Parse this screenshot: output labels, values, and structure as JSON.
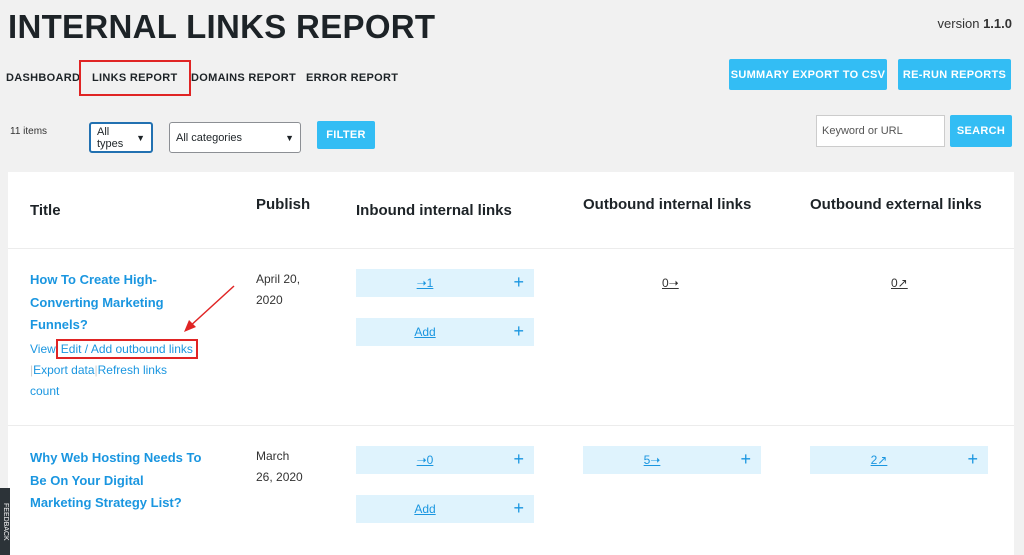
{
  "header": {
    "title": "INTERNAL LINKS REPORT",
    "version_prefix": "version ",
    "version_number": "1.1.0"
  },
  "tabs": [
    {
      "label": "DASHBOARD"
    },
    {
      "label": "LINKS REPORT"
    },
    {
      "label": "DOMAINS REPORT"
    },
    {
      "label": "ERROR REPORT"
    }
  ],
  "buttons": {
    "summary_export": "SUMMARY EXPORT TO CSV",
    "rerun": "RE-RUN REPORTS",
    "filter": "FILTER",
    "search": "SEARCH"
  },
  "filters": {
    "items_count": "11 items",
    "type_selected": "All types",
    "category_selected": "All categories",
    "search_placeholder": "Keyword or URL"
  },
  "table": {
    "headers": {
      "title": "Title",
      "publish": "Publish",
      "inbound": "Inbound internal links",
      "outbound_internal": "Outbound internal links",
      "outbound_external": "Outbound external links"
    },
    "rows": [
      {
        "title_lines": [
          "How To Create High-",
          "Converting Marketing",
          "Funnels?"
        ],
        "date_lines": [
          "April 20,",
          "2020"
        ],
        "actions": {
          "view": "View",
          "edit": "Edit / Add outbound links",
          "export": "Export data",
          "refresh_1": "Refresh links",
          "refresh_2": "count"
        },
        "inbound": "➝1",
        "inbound_add": "Add",
        "outbound_internal": "0➝",
        "outbound_external": "0↗"
      },
      {
        "title_lines": [
          "Why Web Hosting Needs To",
          "Be On Your Digital",
          "Marketing Strategy List?"
        ],
        "date_lines": [
          "March",
          "26, 2020"
        ],
        "inbound": "➝0",
        "inbound_add": "Add",
        "outbound_internal": "5➝",
        "outbound_external": "2↗"
      }
    ]
  },
  "icons": {
    "plus": "+",
    "chevron": "⌵"
  },
  "feedback_label": "FEEDBACK",
  "colors": {
    "accent": "#33bdf4",
    "link": "#1a96e0",
    "highlight": "#e02424",
    "cell_bg": "#dff3fd"
  }
}
